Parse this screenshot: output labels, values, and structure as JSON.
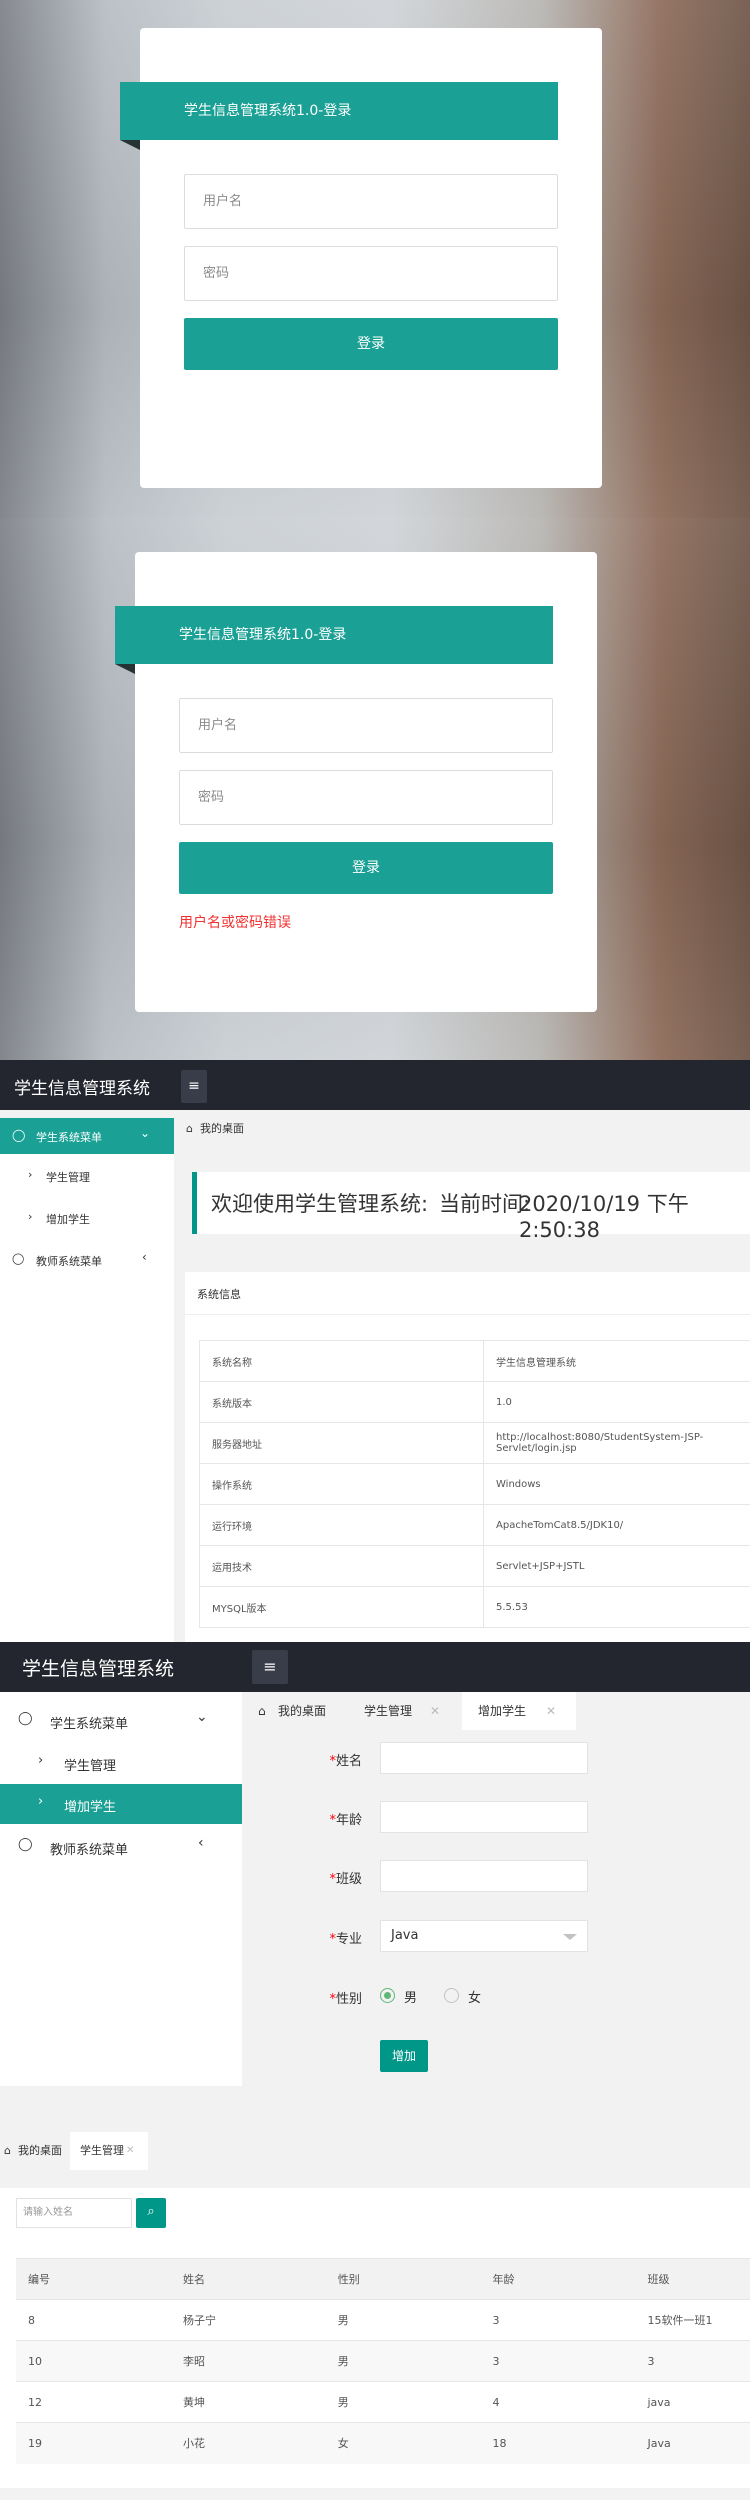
{
  "login": {
    "title": "学生信息管理系统1.0-登录",
    "username_placeholder": "用户名",
    "password_placeholder": "密码",
    "login_button": "登录",
    "error_message": "用户名或密码错误"
  },
  "app": {
    "title": "学生信息管理系统",
    "menu_toggle_icon": "hamburger-icon"
  },
  "sidebar": {
    "student_menu": "学生系统菜单",
    "student_manage": "学生管理",
    "add_student": "增加学生",
    "teacher_menu": "教师系统菜单"
  },
  "dashboard": {
    "breadcrumb": "我的桌面",
    "welcome": "欢迎使用学生管理系统:",
    "time_label": "当前时间:",
    "datetime": "2020/10/19 下午2:50:38",
    "card_title": "系统信息",
    "rows": [
      {
        "k": "系统名称",
        "v": "学生信息管理系统"
      },
      {
        "k": "系统版本",
        "v": "1.0"
      },
      {
        "k": "服务器地址",
        "v": "http://localhost:8080/StudentSystem-JSP-Servlet/login.jsp"
      },
      {
        "k": "操作系统",
        "v": "Windows"
      },
      {
        "k": "运行环境",
        "v": "ApacheTomCat8.5/JDK10/"
      },
      {
        "k": "运用技术",
        "v": "Servlet+JSP+JSTL"
      },
      {
        "k": "MYSQL版本",
        "v": "5.5.53"
      }
    ]
  },
  "tabs": {
    "desktop": "我的桌面",
    "student_manage": "学生管理",
    "add_student": "增加学生"
  },
  "add_form": {
    "name_label": "姓名",
    "age_label": "年龄",
    "class_label": "班级",
    "major_label": "专业",
    "major_value": "Java",
    "gender_label": "性别",
    "male": "男",
    "female": "女",
    "submit": "增加"
  },
  "student_list": {
    "search_placeholder": "请输入姓名",
    "columns": [
      "编号",
      "姓名",
      "性别",
      "年龄",
      "班级"
    ],
    "rows": [
      [
        "8",
        "杨子宁",
        "男",
        "3",
        "15软件一班1"
      ],
      [
        "10",
        "李昭",
        "男",
        "3",
        "3"
      ],
      [
        "12",
        "黄坤",
        "男",
        "4",
        "java"
      ],
      [
        "19",
        "小花",
        "女",
        "18",
        "Java"
      ]
    ]
  }
}
